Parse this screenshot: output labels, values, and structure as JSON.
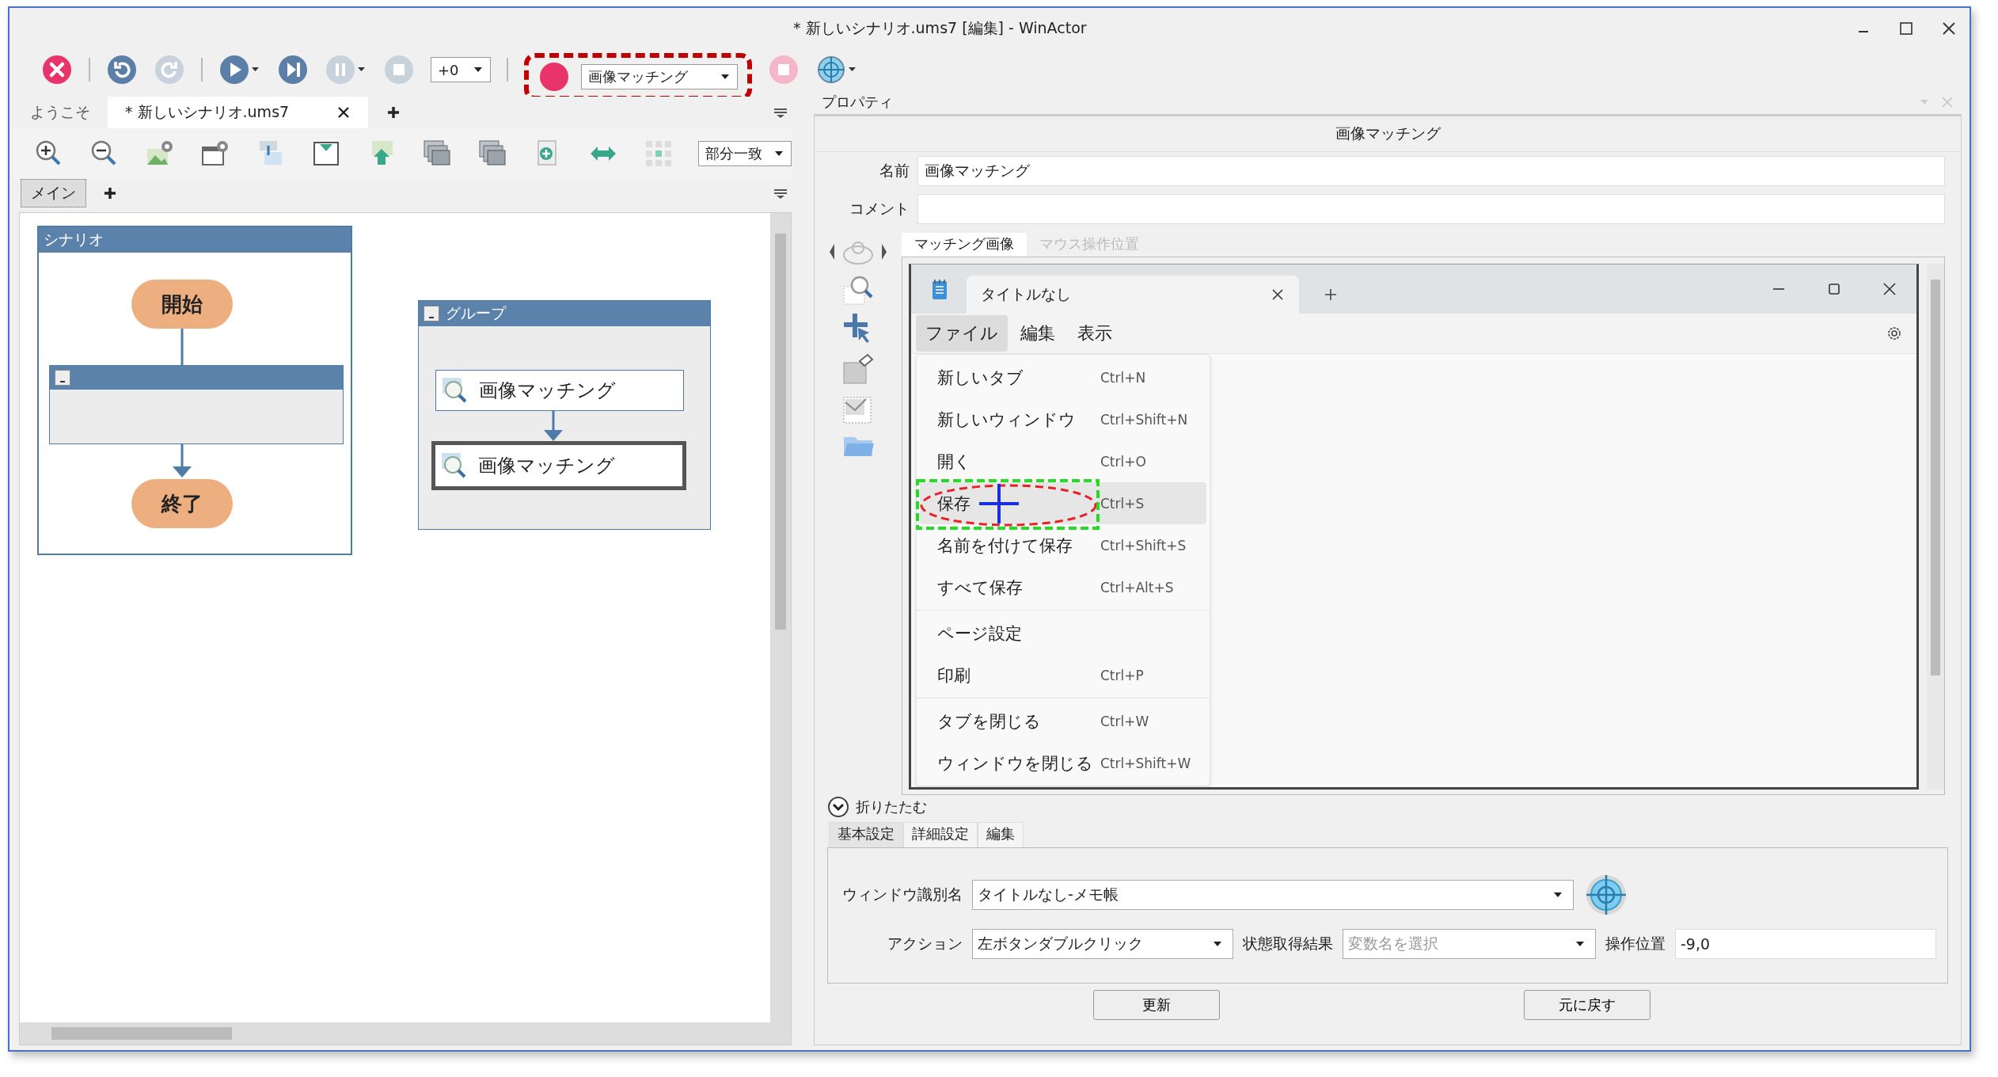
{
  "window": {
    "title": "* 新しいシナリオ.ums7 [編集] - WinActor"
  },
  "toolbar": {
    "buttons": [
      {
        "kind": "stop-all",
        "disabled": false
      },
      {
        "kind": "undo",
        "disabled": false
      },
      {
        "kind": "redo",
        "disabled": true
      },
      {
        "kind": "run",
        "disabled": false
      },
      {
        "kind": "step",
        "disabled": false
      },
      {
        "kind": "pause",
        "disabled": true
      },
      {
        "kind": "stop",
        "disabled": true
      }
    ],
    "speed": "+0",
    "record_mode": "画像マッチング"
  },
  "doc_tabs": [
    {
      "label": "ようこそ",
      "selected": false
    },
    {
      "label": "* 新しいシナリオ.ums7",
      "selected": true
    }
  ],
  "match_mode": "部分一致",
  "sheet_tabs": [
    {
      "label": "メイン",
      "selected": true
    }
  ],
  "flow": {
    "scenario": {
      "title": "シナリオ",
      "start": "開始",
      "end": "終了"
    },
    "group": {
      "title": "グループ",
      "nodes": [
        {
          "label": "画像マッチング",
          "selected": false
        },
        {
          "label": "画像マッチング",
          "selected": true
        }
      ]
    }
  },
  "properties": {
    "pane_title": "プロパティ",
    "node_type": "画像マッチング",
    "fields": [
      {
        "label": "名前",
        "value": "画像マッチング"
      },
      {
        "label": "コメント"
      }
    ],
    "image_tabs": [
      {
        "label": "マッチング画像",
        "selected": true
      },
      {
        "label": "マウス操作位置",
        "selected": false
      }
    ],
    "captured": {
      "tab_title": "タイトルなし",
      "menus": [
        {
          "label": "ファイル",
          "selected": true
        },
        {
          "label": "編集",
          "selected": false
        },
        {
          "label": "表示",
          "selected": false
        }
      ],
      "menu_sections": [
        {
          "items": [
            {
              "label": "新しいタブ",
              "shortcut": "Ctrl+N",
              "highlighted": false
            },
            {
              "label": "新しいウィンドウ",
              "shortcut": "Ctrl+Shift+N",
              "highlighted": false
            },
            {
              "label": "開く",
              "shortcut": "Ctrl+O",
              "highlighted": false
            },
            {
              "label": "保存",
              "shortcut": "Ctrl+S",
              "highlighted": true
            },
            {
              "label": "名前を付けて保存",
              "shortcut": "Ctrl+Shift+S",
              "highlighted": false
            },
            {
              "label": "すべて保存",
              "shortcut": "Ctrl+Alt+S",
              "highlighted": false
            }
          ]
        },
        {
          "items": [
            {
              "label": "ページ設定",
              "highlighted": false
            },
            {
              "label": "印刷",
              "shortcut": "Ctrl+P",
              "highlighted": false
            }
          ]
        },
        {
          "items": [
            {
              "label": "タブを閉じる",
              "shortcut": "Ctrl+W",
              "highlighted": false
            },
            {
              "label": "ウィンドウを閉じる",
              "shortcut": "Ctrl+Shift+W",
              "highlighted": false
            }
          ]
        }
      ]
    },
    "collapse": "折りたたむ",
    "setting_tabs": [
      {
        "label": "基本設定",
        "selected": true
      },
      {
        "label": "詳細設定",
        "selected": false
      },
      {
        "label": "編集",
        "selected": false
      }
    ],
    "settings": {
      "window_name": {
        "label": "ウィンドウ識別名",
        "value": "タイトルなし-メモ帳"
      },
      "action": {
        "label": "アクション",
        "value": "左ボタンダブルクリック"
      },
      "state_result": {
        "label": "状態取得結果",
        "placeholder": "変数名を選択"
      },
      "position": {
        "label": "操作位置",
        "value": "-9,0"
      }
    },
    "buttons": [
      {
        "label": "更新"
      },
      {
        "label": "元に戻す"
      }
    ]
  }
}
